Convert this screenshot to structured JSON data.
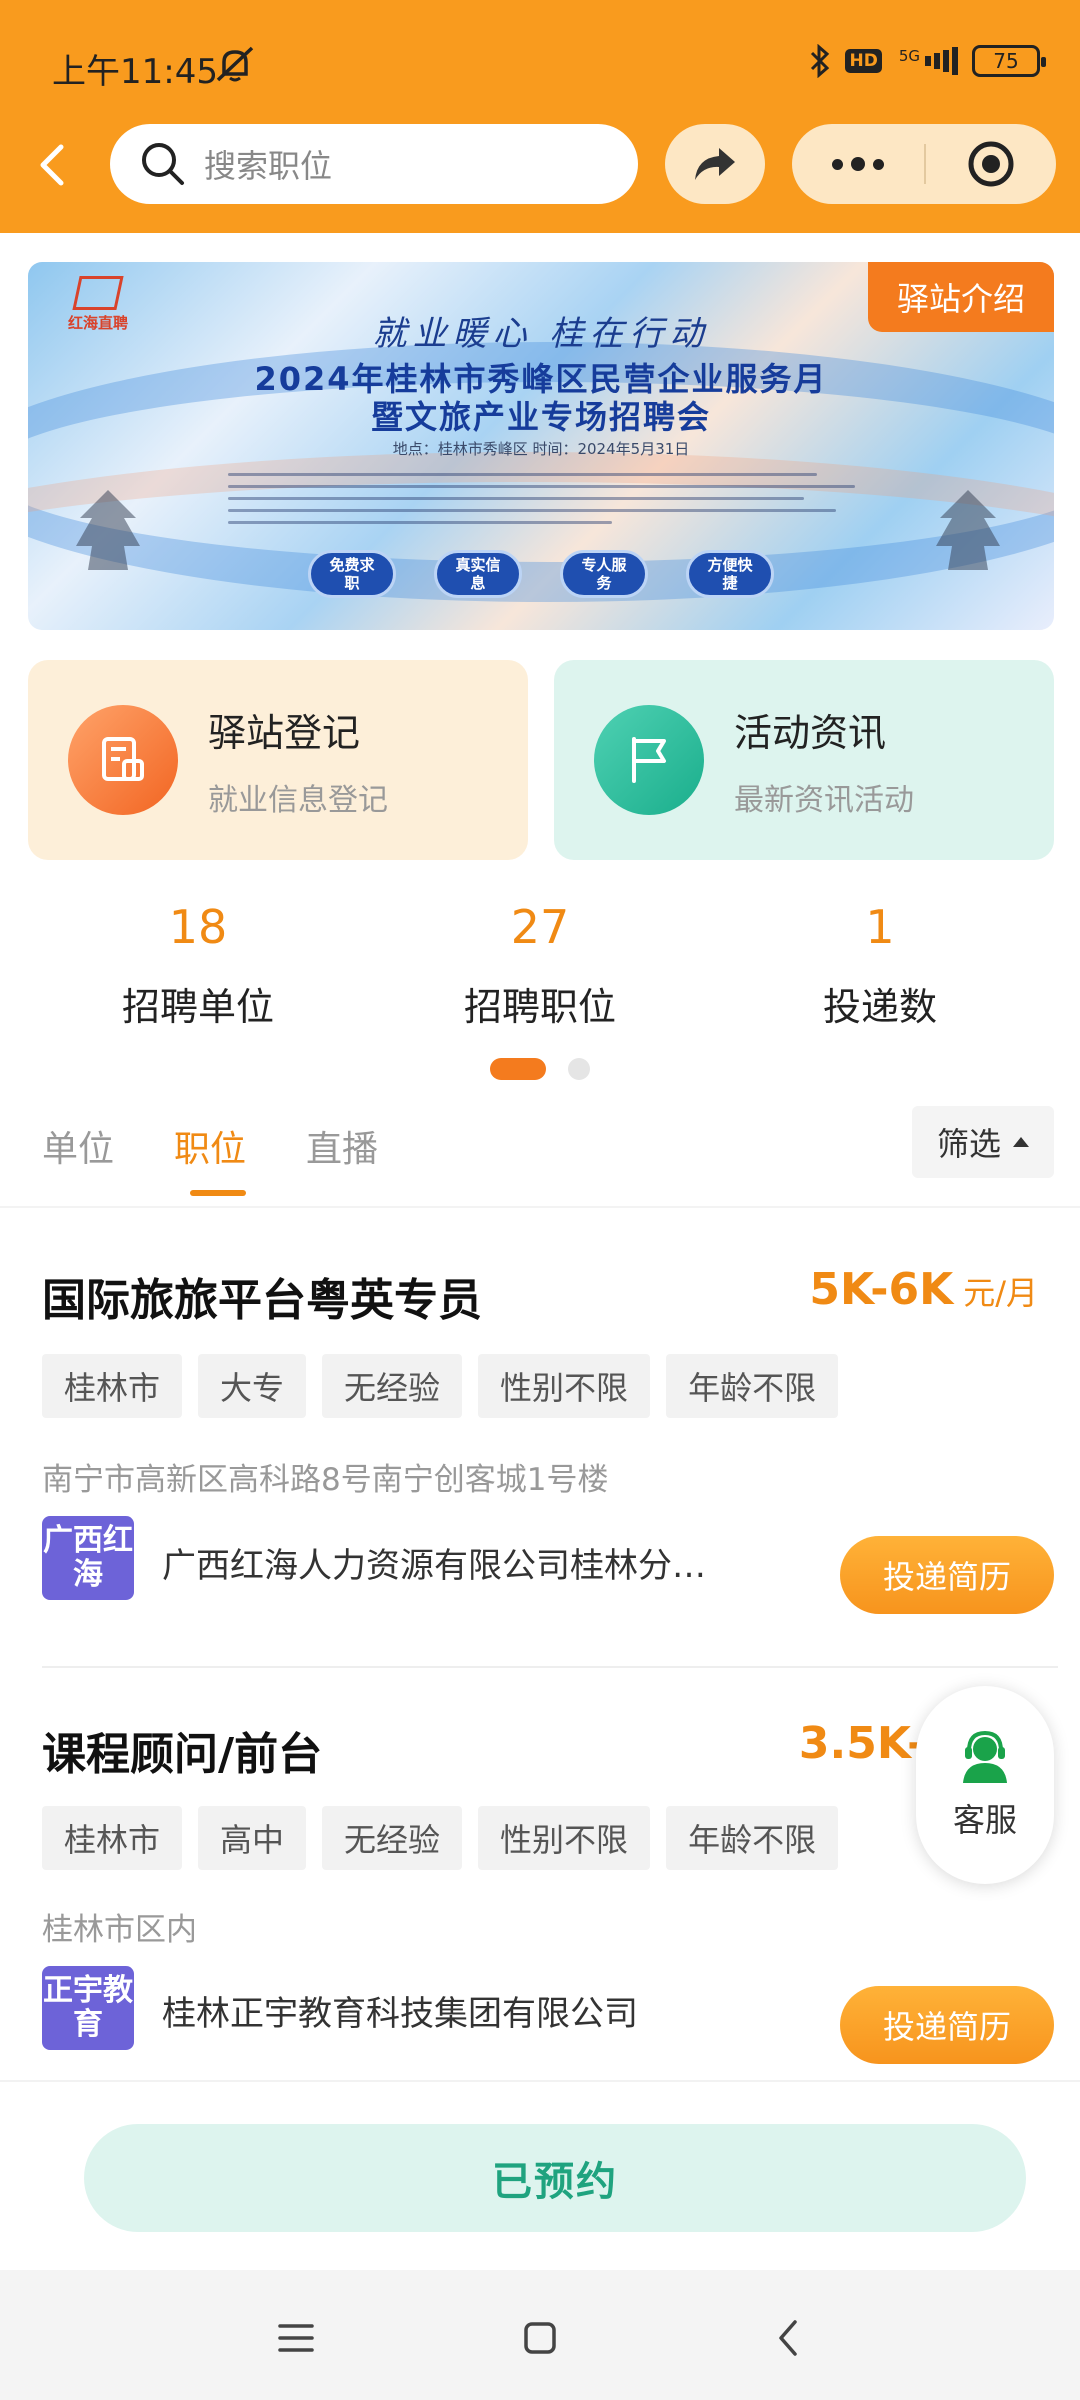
{
  "status_bar": {
    "time": "上午11:45",
    "network": "5G",
    "hd": "HD",
    "battery": "75"
  },
  "header": {
    "search_placeholder": "搜索职位"
  },
  "banner": {
    "brand": "红海直聘",
    "tag": "驿站介绍",
    "slogan": "就业暖心  桂在行动",
    "title_line1": "2024年桂林市秀峰区民营企业服务月",
    "title_line2": "暨文旅产业专场招聘会",
    "info": "地点：桂林市秀峰区          时间：2024年5月31日",
    "badges": [
      "免费求职",
      "真实信息",
      "专人服务",
      "方便快捷"
    ]
  },
  "cards": [
    {
      "title": "驿站登记",
      "subtitle": "就业信息登记"
    },
    {
      "title": "活动资讯",
      "subtitle": "最新资讯活动"
    }
  ],
  "stats": [
    {
      "value": "18",
      "label": "招聘单位"
    },
    {
      "value": "27",
      "label": "招聘职位"
    },
    {
      "value": "1",
      "label": "投递数"
    }
  ],
  "tabs": {
    "items": [
      "单位",
      "职位",
      "直播"
    ],
    "active": "职位",
    "filter": "筛选"
  },
  "jobs": [
    {
      "title": "国际旅旅平台粤英专员",
      "salary": "5K-6K",
      "salary_unit": "元/月",
      "tags": [
        "桂林市",
        "大专",
        "无经验",
        "性别不限",
        "年龄不限"
      ],
      "address": "南宁市高新区高科路8号南宁创客城1号楼",
      "logo_text": "广西红海",
      "company": "广西红海人力资源有限公司桂林分…",
      "apply": "投递简历"
    },
    {
      "title": "课程顾问/前台",
      "salary": "3.5K-4",
      "tags": [
        "桂林市",
        "高中",
        "无经验",
        "性别不限",
        "年龄不限"
      ],
      "address": "桂林市区内",
      "logo_text": "正宇教育",
      "company": "桂林正宇教育科技集团有限公司",
      "apply": "投递简历"
    }
  ],
  "service": {
    "label": "客服"
  },
  "booked": {
    "label": "已预约"
  },
  "colors": {
    "brand_orange": "#F99B1E",
    "accent_orange": "#F08A14",
    "green": "#1FA37F"
  }
}
